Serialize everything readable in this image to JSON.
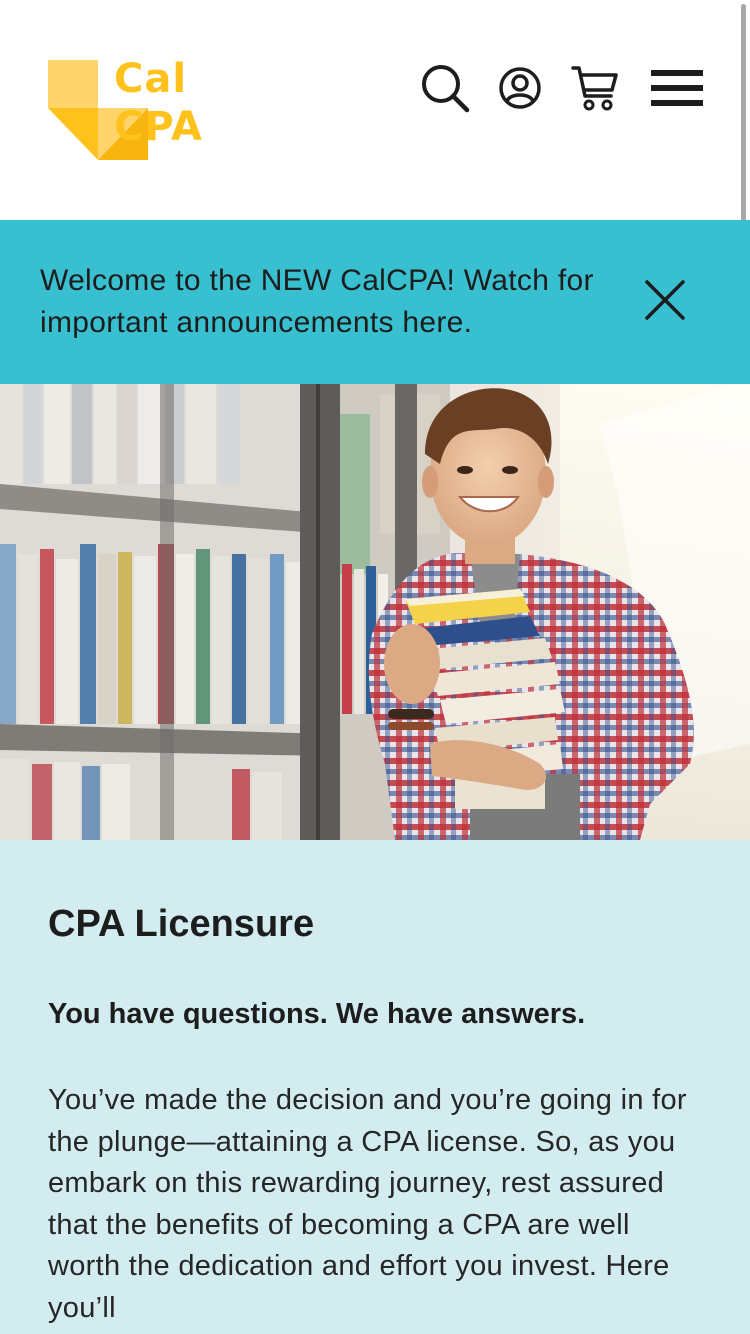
{
  "header": {
    "logo": {
      "line1": "Cal",
      "line2": "CPA",
      "brand_color": "#ffc21d",
      "mark_colors": [
        "#fed46b",
        "#ffc21d",
        "#f9b50f"
      ]
    },
    "icons": {
      "search": "search-icon",
      "account": "user-circle-icon",
      "cart": "shopping-cart-icon",
      "menu": "hamburger-menu-icon"
    }
  },
  "announcement": {
    "text": "Welcome to the NEW CalCPA! Watch for important announcements here.",
    "background": "#38bfd0",
    "close_icon": "close-icon"
  },
  "hero": {
    "image": "student-holding-books-in-library"
  },
  "content": {
    "background": "#d3ecf0",
    "title": "CPA Licensure",
    "subtitle": "You have questions. We have answers.",
    "body": "You’ve made the decision and you’re going in for the plunge—attaining a CPA license. So, as you embark on this rewarding journey, rest assured that the benefits of becoming a CPA are well worth the dedication and effort you invest. Here you’ll"
  }
}
